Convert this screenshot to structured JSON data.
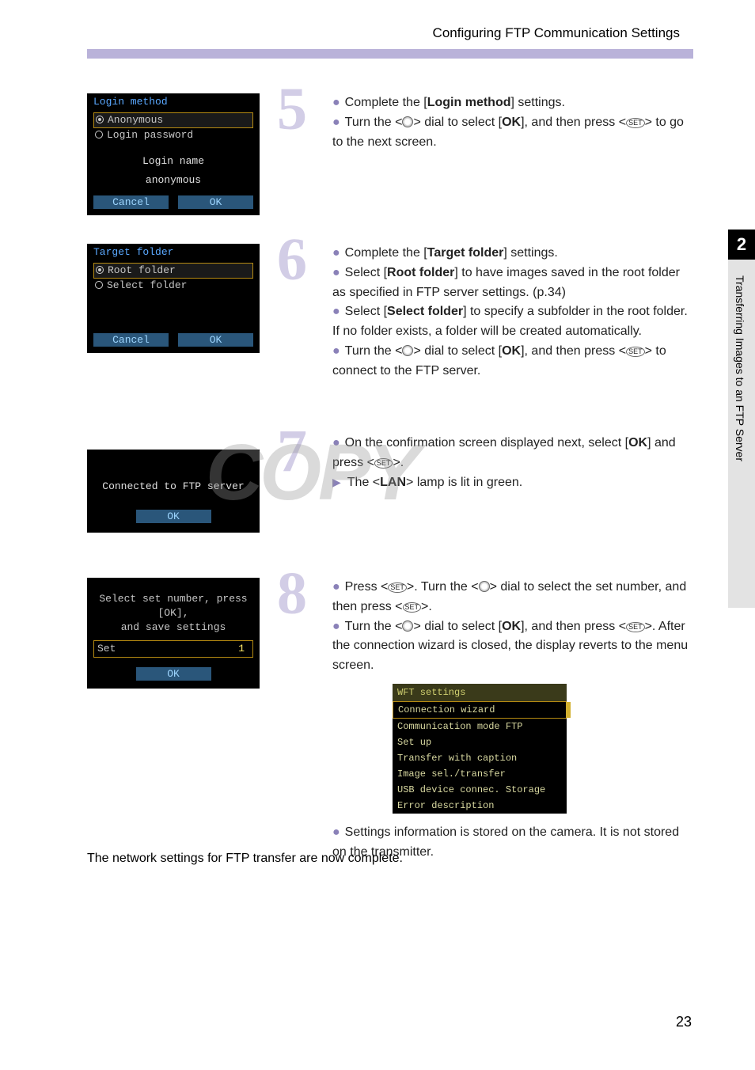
{
  "header": {
    "title": "Configuring FTP Communication Settings"
  },
  "tab": {
    "num": "2",
    "label": "Transferring Images to an FTP Server"
  },
  "screens": {
    "s5": {
      "title": "Login method",
      "opt1": "Anonymous",
      "opt2": "Login password",
      "sub1": "Login name",
      "sub2": "anonymous",
      "cancel": "Cancel",
      "ok": "OK"
    },
    "s6": {
      "title": "Target folder",
      "opt1": "Root folder",
      "opt2": "Select folder",
      "cancel": "Cancel",
      "ok": "OK"
    },
    "s7": {
      "msg": "Connected to FTP server",
      "ok": "OK"
    },
    "s8": {
      "line1": "Select set number, press [OK],",
      "line2": "and save settings",
      "set_label": "Set",
      "set_num": "1",
      "ok": "OK"
    },
    "menu": {
      "title": "WFT settings",
      "i1": "Connection wizard",
      "i2": "Communication mode FTP",
      "i3": "Set up",
      "i4": "Transfer with caption",
      "i5": "Image sel./transfer",
      "i6": "USB device connec. Storage",
      "i7": "Error description"
    }
  },
  "steps": {
    "n5": "5",
    "n6": "6",
    "n7": "7",
    "n8": "8",
    "s5_b1a": "Complete the [",
    "s5_b1b": "Login method",
    "s5_b1c": "] settings.",
    "s5_b2a": "Turn the <",
    "s5_b2b": "> dial to select [",
    "s5_b2c": "OK",
    "s5_b2d": "], and then press <",
    "s5_b2e": "> to go to the next screen.",
    "s6_b1a": "Complete the [",
    "s6_b1b": "Target folder",
    "s6_b1c": "] settings.",
    "s6_b2a": "Select [",
    "s6_b2b": "Root folder",
    "s6_b2c": "] to have images saved in the root folder as specified in FTP server settings. (p.34)",
    "s6_b3a": "Select [",
    "s6_b3b": "Select folder",
    "s6_b3c": "] to specify a subfolder in the root folder. If no folder exists, a folder will be created automatically.",
    "s6_b4a": "Turn the <",
    "s6_b4b": "> dial to select [",
    "s6_b4c": "OK",
    "s6_b4d": "], and then press <",
    "s6_b4e": "> to connect to the FTP server.",
    "s7_b1a": "On the confirmation screen displayed next, select [",
    "s7_b1b": "OK",
    "s7_b1c": "] and press <",
    "s7_b1d": ">.",
    "s7_b2a": "The <",
    "s7_b2b": "LAN",
    "s7_b2c": "> lamp is lit in green.",
    "s8_b1a": "Press <",
    "s8_b1b": ">. Turn the <",
    "s8_b1c": "> dial to select the set number, and then press <",
    "s8_b1d": ">.",
    "s8_b2a": "Turn the <",
    "s8_b2b": "> dial to select [",
    "s8_b2c": "OK",
    "s8_b2d": "], and then press <",
    "s8_b2e": ">. After the connection wizard is closed, the display reverts to the menu screen.",
    "s8_b3": "Settings information is stored on the camera. It is not stored on the transmitter."
  },
  "footer": "The network settings for FTP transfer are now complete.",
  "page": "23",
  "watermark": "COPY",
  "set_icon": "SET"
}
